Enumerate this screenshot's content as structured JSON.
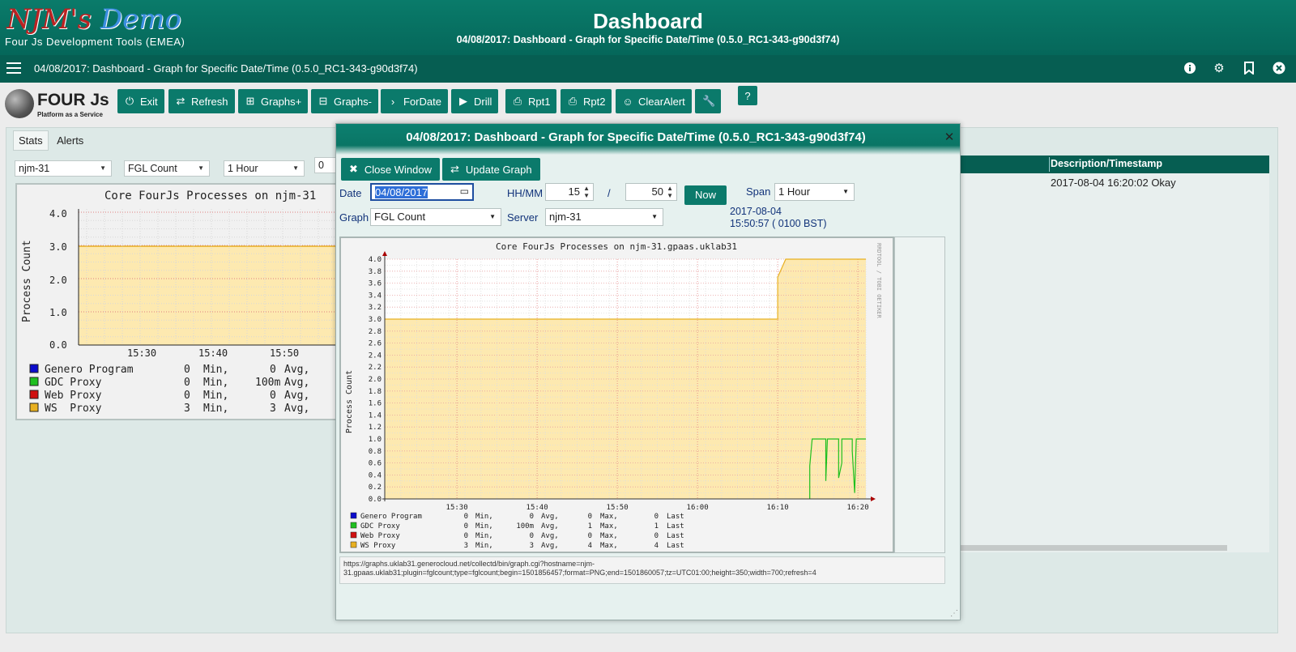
{
  "header": {
    "logo_part1": "NJM's",
    "logo_part2": "Demo",
    "logo_sub": "Four Js Development Tools (EMEA)",
    "title": "Dashboard",
    "subtitle": "04/08/2017: Dashboard - Graph for Specific Date/Time (0.5.0_RC1-343-g90d3f74)"
  },
  "appbar": {
    "title": "04/08/2017: Dashboard - Graph for Specific Date/Time (0.5.0_RC1-343-g90d3f74)",
    "icons": [
      "info-icon",
      "gear-icon",
      "bookmark-icon",
      "close-icon"
    ]
  },
  "toolbar": {
    "brand_text": "FOUR Js",
    "brand_sub": "Platform as a Service",
    "buttons": [
      "Exit",
      "Refresh",
      "Graphs+",
      "Graphs-",
      "ForDate",
      "Drill",
      "Rpt1",
      "Rpt2",
      "ClearAlert"
    ],
    "help_label": "?"
  },
  "main": {
    "tabs": [
      "Stats",
      "Alerts"
    ],
    "server_select": "njm-31",
    "graph_select": "FGL Count",
    "span_select": "1 Hour",
    "small_field": "0",
    "right_header": "Description/Timestamp",
    "right_row": "2017-08-04 16:20:02 Okay"
  },
  "left_graph": {
    "title": "Core FourJs Processes on njm-31",
    "ylabel": "Process Count",
    "yticks": [
      "4.0",
      "3.0",
      "2.0",
      "1.0",
      "0.0"
    ],
    "xticks": [
      "15:30",
      "15:40",
      "15:50"
    ],
    "legend": [
      {
        "name": "Genero Program",
        "min": "0",
        "avg": "0",
        "color": "#0b0bcc"
      },
      {
        "name": "GDC Proxy",
        "min": "0",
        "avg": "100m",
        "color": "#1fbf1f"
      },
      {
        "name": "Web Proxy",
        "min": "0",
        "avg": "0",
        "color": "#d01010"
      },
      {
        "name": "WS  Proxy",
        "min": "3",
        "avg": "3",
        "color": "#e8b020"
      }
    ],
    "min_label": "Min,",
    "avg_label": "Avg,"
  },
  "modal": {
    "title": "04/08/2017: Dashboard - Graph for Specific Date/Time (0.5.0_RC1-343-g90d3f74)",
    "close_window": "Close Window",
    "update_graph": "Update Graph",
    "date_label": "Date",
    "date_value": "04/08/2017",
    "hhmm_label": "HH/MM",
    "hour_value": "15",
    "slash": "/",
    "minute_value": "50",
    "now_label": "Now",
    "span_label": "Span",
    "span_value": "1 Hour",
    "graph_label": "Graph",
    "graph_value": "FGL Count",
    "server_label": "Server",
    "server_value": "njm-31",
    "timestamp_date": "2017-08-04",
    "timestamp_time": "15:50:57 ( 0100 BST)",
    "url": "https://graphs.uklab31.generocloud.net/collectd/bin/graph.cgi?hostname=njm-31.gpaas.uklab31;plugin=fglcount;type=fglcount;begin=1501856457;format=PNG;end=1501860057;tz=UTC01:00;height=350;width=700;refresh=4"
  },
  "chart_data": {
    "type": "area",
    "title": "Core FourJs Processes on njm-31.gpaas.uklab31",
    "ylabel": "Process Count",
    "side_text": "RRDTOOL / TOBI OETIKER",
    "ylim": [
      0,
      4
    ],
    "xlim": [
      "15:21",
      "16:21"
    ],
    "yticks": [
      "0.0",
      "0.2",
      "0.4",
      "0.6",
      "0.8",
      "1.0",
      "1.2",
      "1.4",
      "1.6",
      "1.8",
      "2.0",
      "2.2",
      "2.4",
      "2.6",
      "2.8",
      "3.0",
      "3.2",
      "3.4",
      "3.6",
      "3.8",
      "4.0"
    ],
    "xticks": [
      "15:30",
      "15:40",
      "15:50",
      "16:00",
      "16:10",
      "16:20"
    ],
    "grid": true,
    "series": [
      {
        "name": "WS  Proxy",
        "color": "#e8b020",
        "fill": "#fde9b0",
        "points": [
          [
            "15:21",
            3
          ],
          [
            "16:10",
            3
          ],
          [
            "16:10",
            3.7
          ],
          [
            "16:11",
            4
          ],
          [
            "16:21",
            4
          ]
        ]
      },
      {
        "name": "GDC Proxy",
        "color": "#1fbf1f",
        "points": [
          [
            "16:14",
            0
          ],
          [
            "16:14",
            0.55
          ],
          [
            "16:14.3",
            1
          ],
          [
            "16:16",
            1
          ],
          [
            "16:16",
            0.3
          ],
          [
            "16:16.2",
            1
          ],
          [
            "16:17.6",
            1
          ],
          [
            "16:17.6",
            0.35
          ],
          [
            "16:18",
            0.6
          ],
          [
            "16:18",
            1
          ],
          [
            "16:19.3",
            1
          ],
          [
            "16:19.3",
            0.8
          ],
          [
            "16:19.6",
            0.1
          ],
          [
            "16:19.8",
            1
          ],
          [
            "16:21",
            1
          ]
        ]
      }
    ],
    "legend": [
      {
        "name": "Genero Program",
        "min": "0",
        "avg": "0",
        "max": "0",
        "last": "0",
        "color": "#0b0bcc"
      },
      {
        "name": "GDC Proxy",
        "min": "0",
        "avg": "100m",
        "max": "1",
        "last": "1",
        "color": "#1fbf1f"
      },
      {
        "name": "Web Proxy",
        "min": "0",
        "avg": "0",
        "max": "0",
        "last": "0",
        "color": "#d01010"
      },
      {
        "name": "WS  Proxy",
        "min": "3",
        "avg": "3",
        "max": "4",
        "last": "4",
        "color": "#e8b020"
      }
    ],
    "stat_labels": [
      "Min,",
      "Avg,",
      "Max,",
      "Last"
    ]
  }
}
